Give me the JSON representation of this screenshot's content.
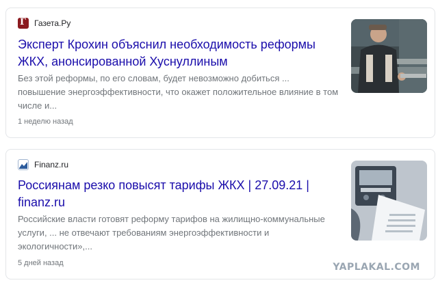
{
  "results": [
    {
      "source": "Газета.Ру",
      "favicon_icon": "gazeta-favicon-icon",
      "title": "Эксперт Крохин объяснил необходимость реформы ЖКХ, анонсированной Хуснуллиным",
      "snippet": "Без этой реформы, по его словам, будет невозможно добиться ... повышение энергоэффективности, что окажет положительное влияние в том числе и...",
      "time": "1 неделю назад",
      "thumbnail": "worker-pipes-photo"
    },
    {
      "source": "Finanz.ru",
      "favicon_icon": "finanz-favicon-icon",
      "title": "Россиянам резко повысят тарифы ЖКХ | 27.09.21 | finanz.ru",
      "snippet": "Российские власти готовят реформу тарифов на жилищно-коммунальные услуги, ... не отвечают требованиям энергоэффективности и экологичности»,...",
      "time": "5 дней назад",
      "thumbnail": "electric-meter-photo"
    }
  ],
  "watermark": "YAPLAKAL.COM",
  "colors": {
    "title_link": "#1a0dab",
    "snippet": "#70757a",
    "card_border": "#e3e5e8",
    "gazeta_brand": "#8b1a1f"
  }
}
